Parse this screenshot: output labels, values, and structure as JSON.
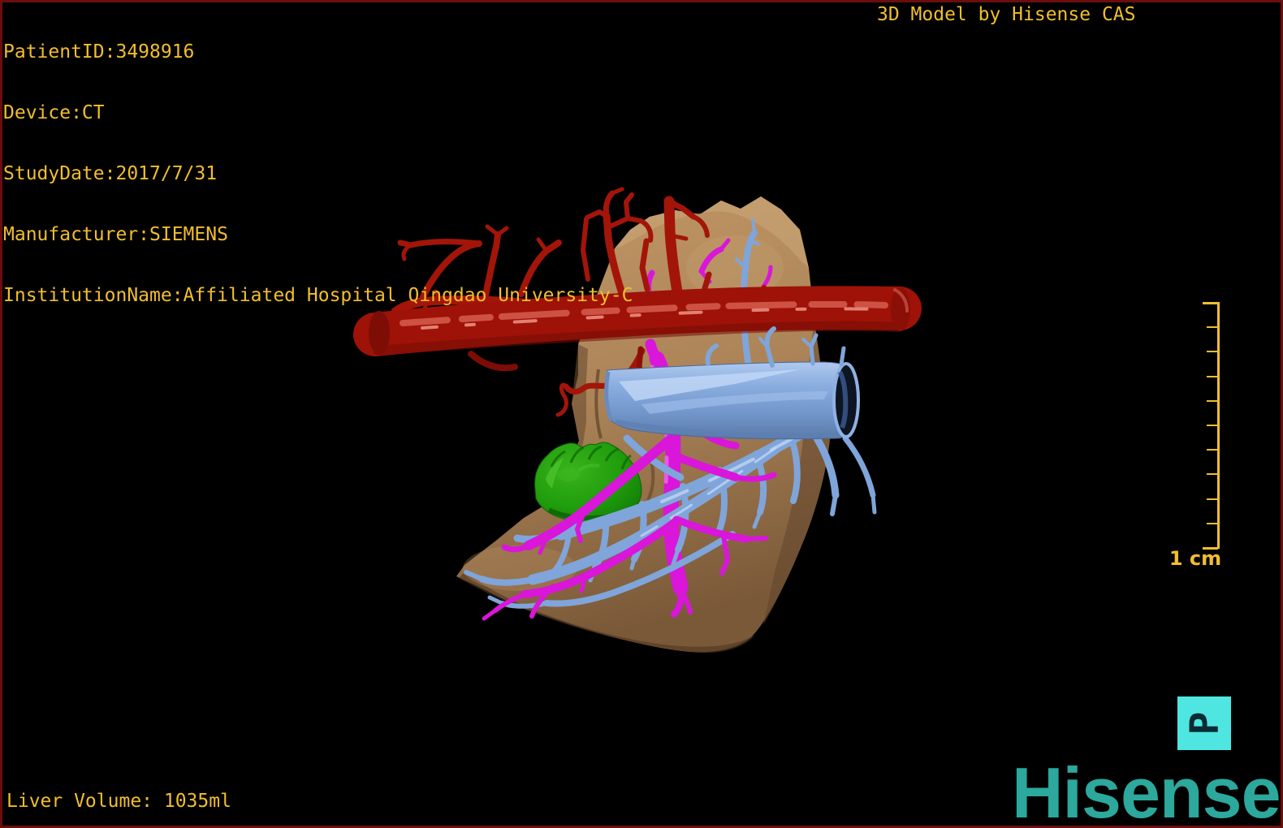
{
  "colors": {
    "background": "#000000",
    "frame_border": "#6B0D0D",
    "overlay_text": "#F2BE2E",
    "scale_bar": "#F2BE2E",
    "marker_bg": "#4FE6E1",
    "marker_glyph": "#0B2B33",
    "brand_teal": "#2CA89C",
    "liver_tan": "#B68C5C",
    "artery_red": "#9E1207",
    "vein_blue": "#7DA2D8",
    "portal_magenta": "#D916D9",
    "tumor_green": "#1F9C0C"
  },
  "overlay": {
    "patient_info": [
      "PatientID:3498916",
      "Device:CT",
      "StudyDate:2017/7/31",
      "Manufacturer:SIEMENS",
      "InstitutionName:Affiliated Hospital Qingdao University-C"
    ],
    "watermark": "3D Model by Hisense CAS",
    "liver_volume": "Liver Volume: 1035ml"
  },
  "scale_bar": {
    "label": "1 cm",
    "divisions": 10
  },
  "orientation_marker": {
    "letter": "P"
  },
  "brand": {
    "logo_text": "Hisense"
  },
  "model": {
    "structures": [
      {
        "name": "liver-parenchyma",
        "color": "#B68C5C"
      },
      {
        "name": "hepatic-artery",
        "color": "#9E1207"
      },
      {
        "name": "vena-cava-tube",
        "color": "#7DA2D8"
      },
      {
        "name": "hepatic-vein-branches",
        "color": "#7FA5DA"
      },
      {
        "name": "portal-vein-branches",
        "color": "#D916D9"
      },
      {
        "name": "tumor",
        "color": "#1F9C0C"
      }
    ]
  }
}
